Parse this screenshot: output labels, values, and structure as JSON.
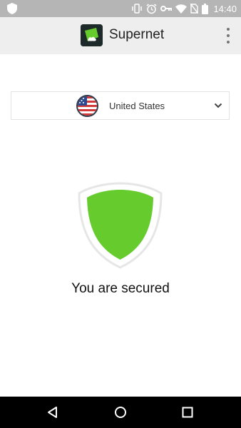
{
  "status_bar": {
    "time": "14:40",
    "icons": [
      "shield-icon",
      "vibrate-icon",
      "alarm-icon",
      "vpn-key-icon",
      "wifi-icon",
      "no-sim-icon",
      "battery-icon"
    ]
  },
  "app_bar": {
    "title": "Supernet",
    "logo_icon": "supernet-logo-icon",
    "menu_icon": "overflow-menu-icon"
  },
  "location": {
    "selected_country": "United States",
    "flag_icon": "us-flag-icon",
    "dropdown_icon": "chevron-down-icon"
  },
  "connection": {
    "status_text": "You are secured",
    "state_icon": "shield-icon",
    "state_color": "#66cc2d"
  },
  "nav_bar": {
    "buttons": [
      "back-icon",
      "home-icon",
      "recents-icon"
    ]
  },
  "colors": {
    "status_bar": "#b5b5b5",
    "app_bar": "#eeeeee",
    "accent_green": "#66cc2d",
    "nav_bar": "#000000"
  }
}
